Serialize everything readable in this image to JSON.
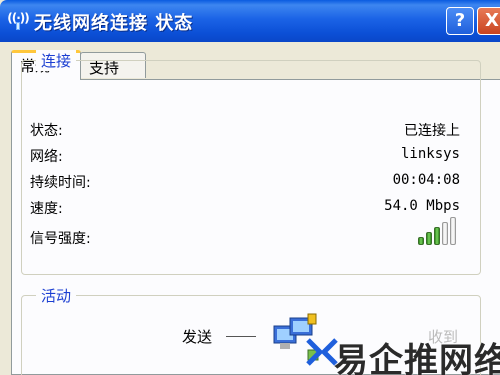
{
  "window": {
    "title": "无线网络连接 状态",
    "help_label": "?",
    "close_label": "X"
  },
  "tabs": [
    {
      "label": "常规",
      "active": true
    },
    {
      "label": "支持",
      "active": false
    }
  ],
  "connection": {
    "group_title": "连接",
    "status_label": "状态:",
    "status_value": "已连接上",
    "network_label": "网络:",
    "network_value": "linksys",
    "duration_label": "持续时间:",
    "duration_value": "00:04:08",
    "speed_label": "速度:",
    "speed_value": "54.0 Mbps",
    "signal_label": "信号强度:",
    "signal_bars_lit": 3,
    "signal_bars_total": 5
  },
  "activity": {
    "group_title": "活动",
    "sent_label": "发送",
    "received_label": "收到"
  },
  "watermark": {
    "text": "易企推网络"
  },
  "colors": {
    "titlebar": "#1b63e6",
    "group_title": "#1c3fd2",
    "tab_accent": "#ffc73c",
    "signal_on": "#4caf2e"
  }
}
